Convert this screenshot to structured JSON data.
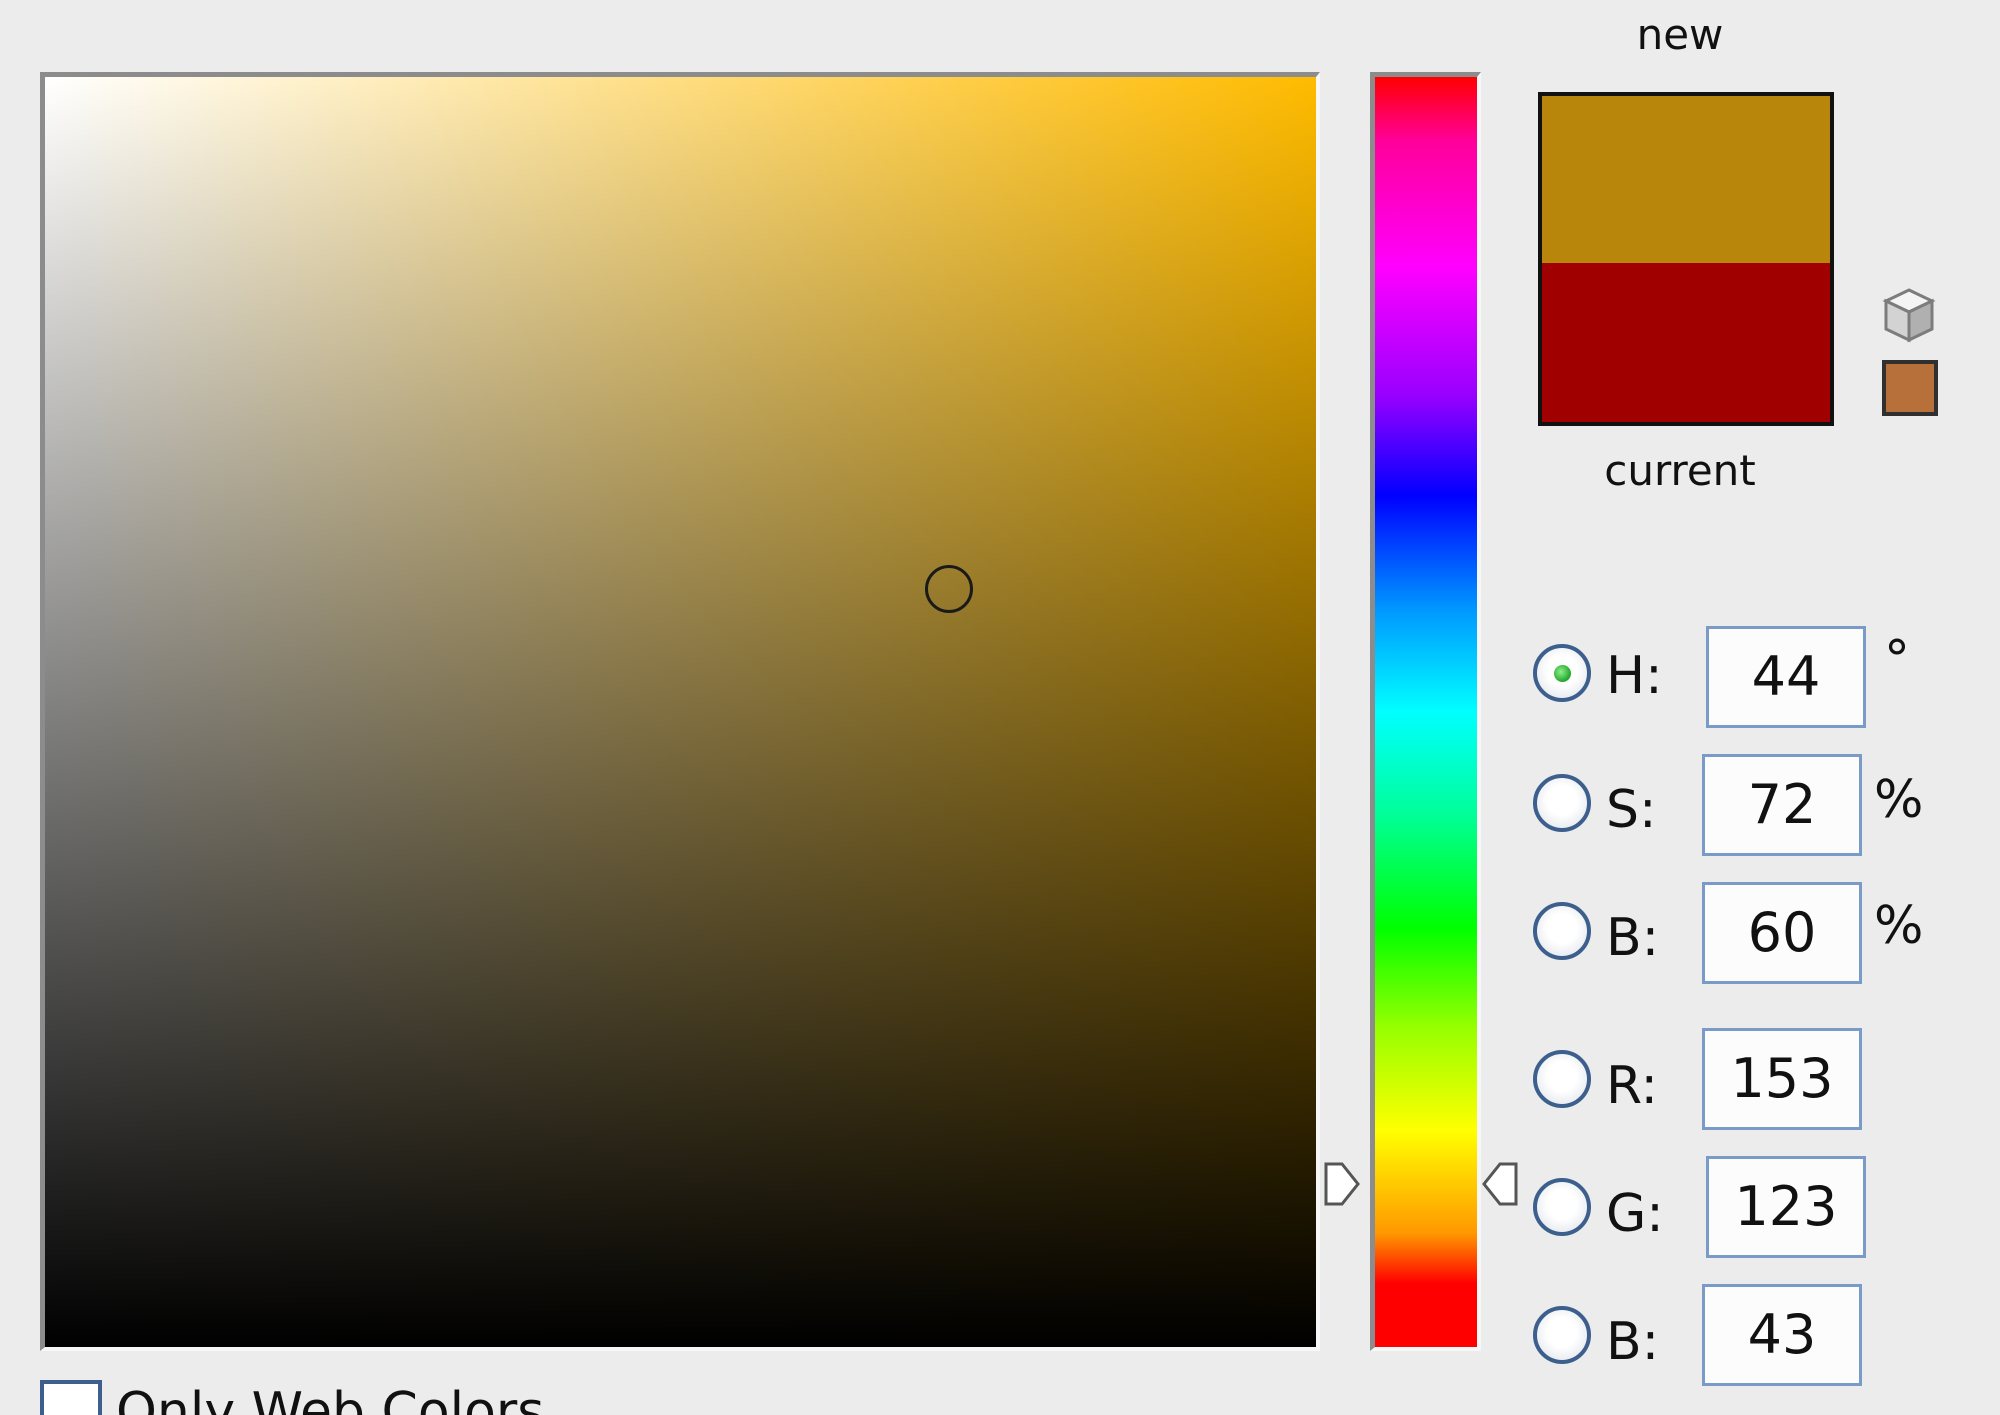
{
  "picker": {
    "hue_degrees": 44,
    "marker_saturation_fraction": 0.72,
    "marker_brightness_fraction": 0.6,
    "hue_slider_position_fraction": 0.88
  },
  "swatches": {
    "new_label": "new",
    "current_label": "current",
    "new_color": "#b8860b",
    "current_color": "#a00000",
    "websafe_color": "#b8703a"
  },
  "icons": {
    "gamut_warning": "cube-icon",
    "hue_slider_arrows": "triangle-arrow-icon",
    "selected_marker": "circle-marker-icon"
  },
  "fields": {
    "hue": {
      "label": "H:",
      "value": "44",
      "unit": "°",
      "selected": true
    },
    "saturation": {
      "label": "S:",
      "value": "72",
      "unit": "%",
      "selected": false
    },
    "brightness": {
      "label": "B:",
      "value": "60",
      "unit": "%",
      "selected": false
    },
    "red": {
      "label": "R:",
      "value": "153",
      "selected": false
    },
    "green": {
      "label": "G:",
      "value": "123",
      "selected": false
    },
    "blue": {
      "label": "B:",
      "value": "43",
      "selected": false
    }
  },
  "options": {
    "only_web_colors_label": "Only Web Colors",
    "only_web_colors_checked": false
  }
}
